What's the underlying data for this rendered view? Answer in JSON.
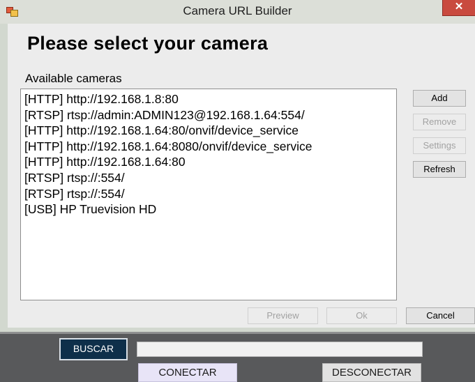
{
  "window": {
    "title": "Camera URL Builder",
    "close_symbol": "✕"
  },
  "dialog": {
    "heading": "Please select your camera",
    "list_label": "Available cameras",
    "cameras": [
      "[HTTP] http://192.168.1.8:80",
      "[RTSP] rtsp://admin:ADMIN123@192.168.1.64:554/",
      "[HTTP] http://192.168.1.64:80/onvif/device_service",
      "[HTTP] http://192.168.1.64:8080/onvif/device_service",
      "[HTTP] http://192.168.1.64:80",
      "[RTSP] rtsp://:554/",
      "[RTSP] rtsp://:554/",
      "[USB] HP Truevision HD"
    ],
    "buttons": {
      "add": "Add",
      "remove": "Remove",
      "settings": "Settings",
      "refresh": "Refresh",
      "preview": "Preview",
      "ok": "Ok",
      "cancel": "Cancel"
    }
  },
  "panel": {
    "search_button": "BUSCAR",
    "search_value": "",
    "connect_button": "CONECTAR",
    "disconnect_button": "DESCONECTAR"
  }
}
